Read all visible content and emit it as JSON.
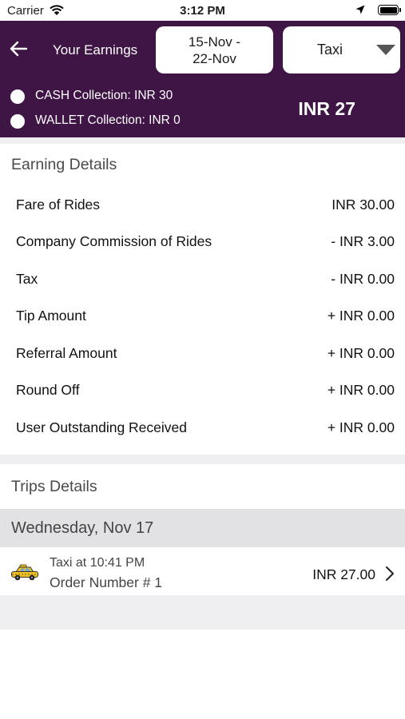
{
  "status_bar": {
    "carrier": "Carrier",
    "time": "3:12 PM"
  },
  "header": {
    "title": "Your Earnings",
    "date_range_line1": "15-Nov -",
    "date_range_line2": "22-Nov",
    "vehicle_type": "Taxi",
    "cash_collection": "CASH Collection: INR 30",
    "wallet_collection": "WALLET Collection: INR 0",
    "total": "INR 27",
    "background_color": "#3f1545"
  },
  "earning_details": {
    "title": "Earning Details",
    "rows": [
      {
        "label": "Fare of Rides",
        "value": "INR 30.00"
      },
      {
        "label": "Company Commission of Rides",
        "value": "- INR 3.00"
      },
      {
        "label": "Tax",
        "value": "- INR 0.00"
      },
      {
        "label": "Tip Amount",
        "value": "+ INR 0.00"
      },
      {
        "label": "Referral Amount",
        "value": "+ INR 0.00"
      },
      {
        "label": "Round Off",
        "value": "+ INR 0.00"
      },
      {
        "label": "User Outstanding Received",
        "value": "+ INR 0.00"
      }
    ]
  },
  "trips_details": {
    "title": "Trips Details",
    "day": "Wednesday, Nov 17",
    "trip": {
      "icon": "taxi-icon",
      "time_line": "Taxi at 10:41 PM",
      "order_line": "Order Number # 1",
      "amount": "INR 27.00"
    }
  }
}
